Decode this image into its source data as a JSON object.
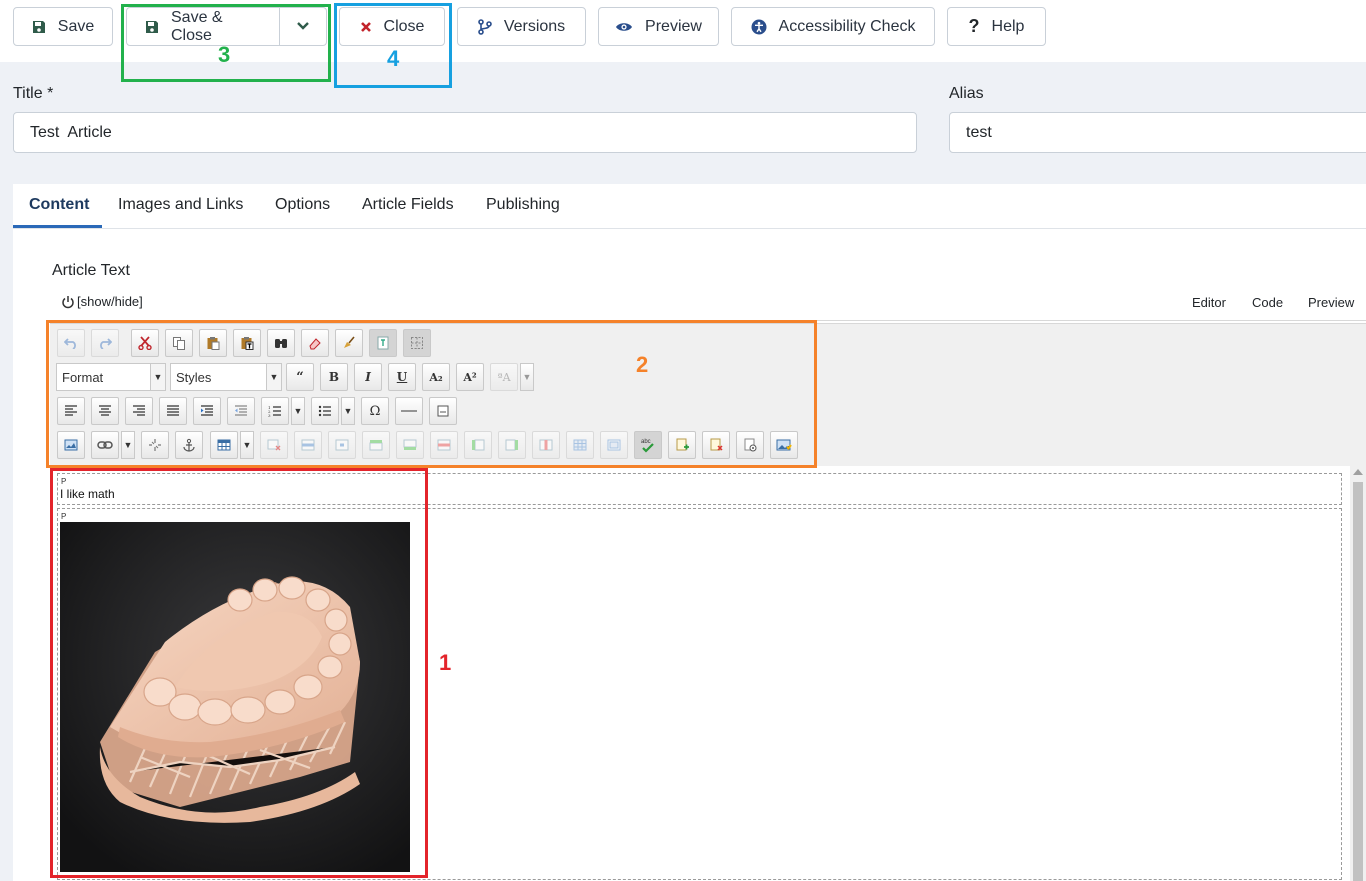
{
  "toolbar": {
    "save": "Save",
    "save_close": "Save & Close",
    "close": "Close",
    "versions": "Versions",
    "preview": "Preview",
    "accessibility": "Accessibility Check",
    "help": "Help"
  },
  "form": {
    "title_label": "Title *",
    "title_value": "Test  Article",
    "alias_label": "Alias",
    "alias_value": "test"
  },
  "tabs": [
    "Content",
    "Images and Links",
    "Options",
    "Article Fields",
    "Publishing"
  ],
  "editor": {
    "field_label": "Article Text",
    "toggle_label": "[show/hide]",
    "modes": [
      "Editor",
      "Code",
      "Preview"
    ],
    "format_select": "Format",
    "styles_select": "Styles",
    "paragraph_tag": "P",
    "paragraph_text": "I like math"
  },
  "annotations": {
    "n1": "1",
    "n2": "2",
    "n3": "3",
    "n4": "4",
    "colors": {
      "red": "#e3242b",
      "orange": "#f5822a",
      "green": "#22b14c",
      "blue": "#16a0e0"
    }
  }
}
